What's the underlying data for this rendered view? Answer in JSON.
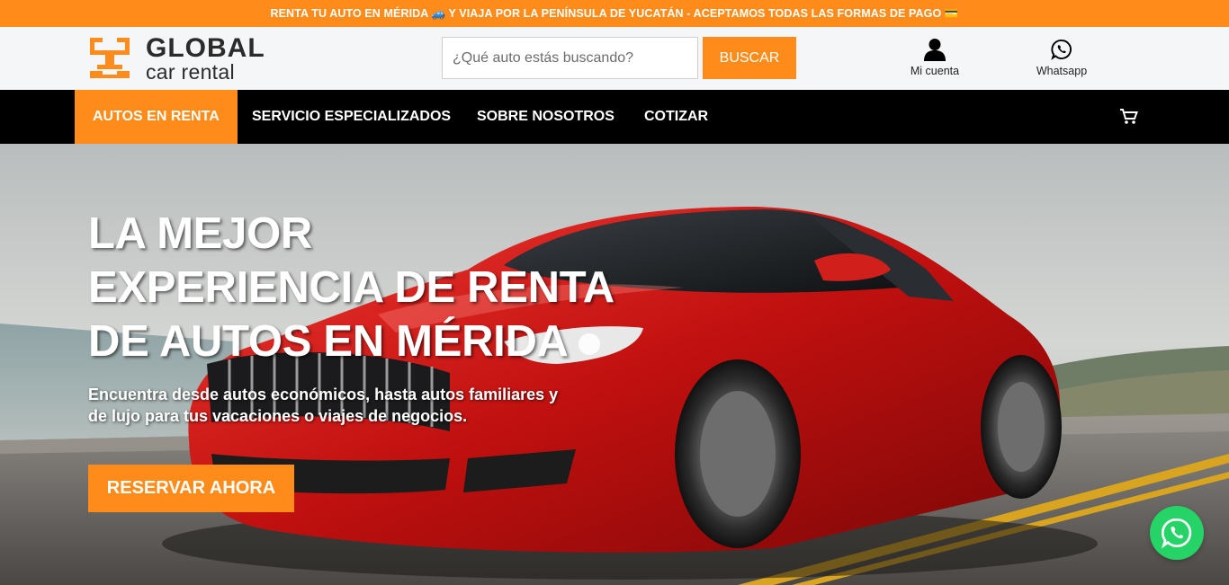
{
  "announcement": {
    "text": "RENTA TU AUTO EN MÉRIDA 🚙 Y VIAJA POR LA PENÍNSULA DE YUCATÁN - ACEPTAMOS TODAS LAS FORMAS DE PAGO 💳"
  },
  "brand": {
    "line1": "GLOBAL",
    "line2": "car rental",
    "accent_color": "#ff8c1a"
  },
  "search": {
    "placeholder": "¿Qué auto estás buscando?",
    "value": "",
    "button_label": "BUSCAR"
  },
  "header_links": {
    "account_label": "Mi cuenta",
    "account_icon": "user-icon",
    "whatsapp_label": "Whatsapp",
    "whatsapp_icon": "whatsapp-icon"
  },
  "nav": {
    "items": [
      {
        "label": "AUTOS EN RENTA",
        "active": true
      },
      {
        "label": "SERVICIO ESPECIALIZADOS",
        "active": false
      },
      {
        "label": "SOBRE NOSOTROS",
        "active": false
      },
      {
        "label": "COTIZAR",
        "active": false
      }
    ],
    "cart_icon": "cart-icon"
  },
  "hero": {
    "title_lines": [
      "LA MEJOR",
      "EXPERIENCIA DE RENTA",
      "DE AUTOS EN MÉRIDA"
    ],
    "subtitle_lines": [
      "Encuentra desde autos económicos, hasta autos familiares y",
      "de lujo para tus vacaciones o viajes de negocios."
    ],
    "cta_label": "RESERVAR AHORA"
  },
  "floating": {
    "whatsapp_icon": "whatsapp-icon",
    "color": "#25d366"
  }
}
